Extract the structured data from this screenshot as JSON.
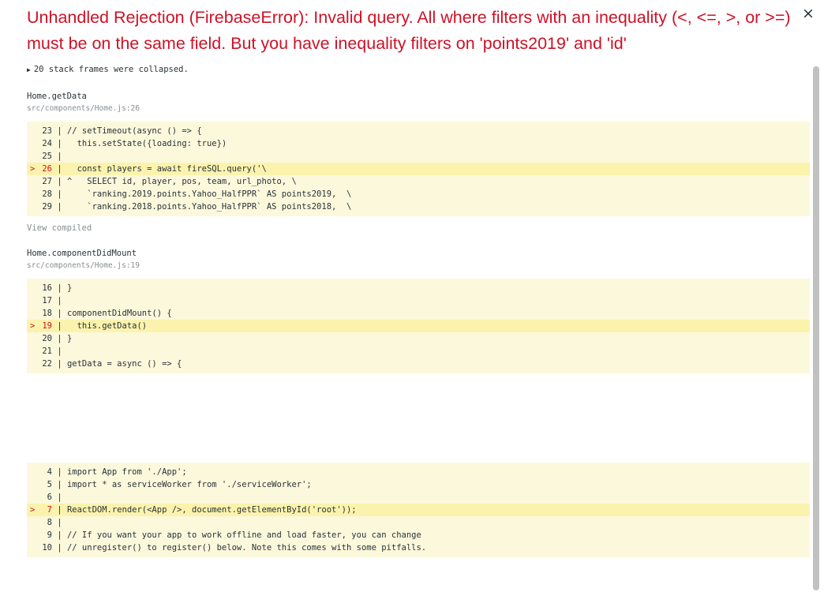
{
  "error": {
    "title": "Unhandled Rejection (FirebaseError): Invalid query. All where filters with an inequality (<, <=, >, or >=) must be on the same field. But you have inequality filters on 'points2019' and 'id'",
    "close_symbol": "×"
  },
  "collapsed_frames": {
    "text": "20 stack frames were collapsed.",
    "icon": "triangle-right-icon"
  },
  "frames": [
    {
      "function": "Home.getData",
      "file": "src/components/Home.js:26",
      "lines": [
        {
          "num": "23",
          "code": "// setTimeout(async () => {",
          "highlight": false
        },
        {
          "num": "24",
          "code": "  this.setState({loading: true})",
          "highlight": false
        },
        {
          "num": "25",
          "code": "",
          "highlight": false
        },
        {
          "num": "26",
          "code": "  const players = await fireSQL.query('\\",
          "highlight": true
        },
        {
          "num": "27",
          "code": "^   SELECT id, player, pos, team, url_photo, \\",
          "highlight": false
        },
        {
          "num": "28",
          "code": "    `ranking.2019.points.Yahoo_HalfPPR` AS points2019,  \\",
          "highlight": false
        },
        {
          "num": "29",
          "code": "    `ranking.2018.points.Yahoo_HalfPPR` AS points2018,  \\",
          "highlight": false
        }
      ],
      "view_compiled": "View compiled"
    },
    {
      "function": "Home.componentDidMount",
      "file": "src/components/Home.js:19",
      "lines": [
        {
          "num": "16",
          "code": "}",
          "highlight": false
        },
        {
          "num": "17",
          "code": "",
          "highlight": false
        },
        {
          "num": "18",
          "code": "componentDidMount() {",
          "highlight": false
        },
        {
          "num": "19",
          "code": "  this.getData()",
          "highlight": true
        },
        {
          "num": "20",
          "code": "}",
          "highlight": false
        },
        {
          "num": "21",
          "code": "",
          "highlight": false
        },
        {
          "num": "22",
          "code": "getData = async () => {",
          "highlight": false
        }
      ]
    },
    {
      "lines": [
        {
          "num": "4",
          "code": "import App from './App';",
          "highlight": false
        },
        {
          "num": "5",
          "code": "import * as serviceWorker from './serviceWorker';",
          "highlight": false
        },
        {
          "num": "6",
          "code": "",
          "highlight": false
        },
        {
          "num": "7",
          "code": "ReactDOM.render(<App />, document.getElementById('root'));",
          "highlight": true
        },
        {
          "num": "8",
          "code": "",
          "highlight": false
        },
        {
          "num": "9",
          "code": "// If you want your app to work offline and load faster, you can change",
          "highlight": false
        },
        {
          "num": "10",
          "code": "// unregister() to register() below. Note this comes with some pitfalls.",
          "highlight": false
        }
      ]
    }
  ],
  "highlight_marker": ">"
}
